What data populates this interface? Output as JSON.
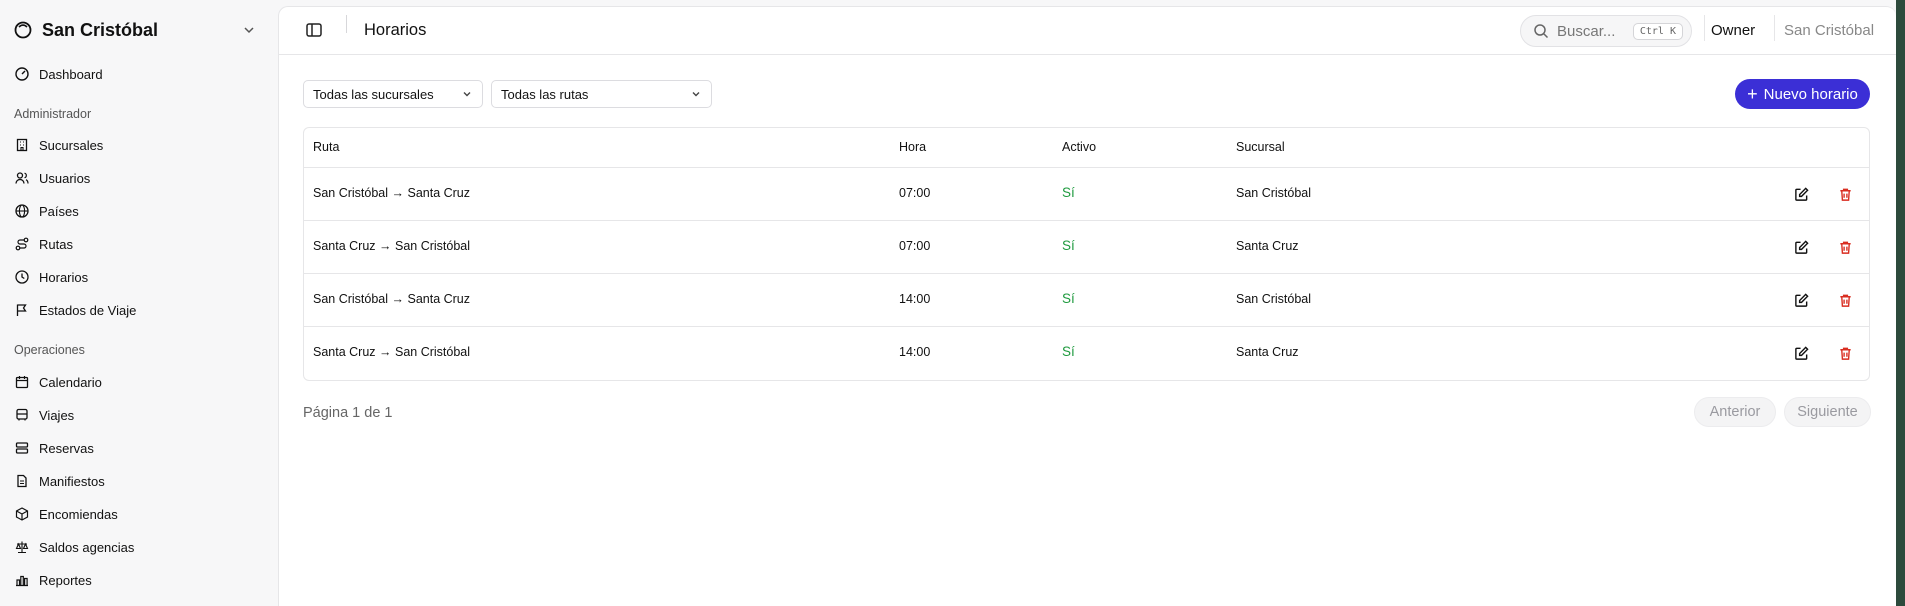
{
  "brand": {
    "name": "San Cristóbal"
  },
  "sidebar": {
    "dashboard": "Dashboard",
    "admin_label": "Administrador",
    "admin_items": [
      "Sucursales",
      "Usuarios",
      "Países",
      "Rutas",
      "Horarios",
      "Estados de Viaje"
    ],
    "ops_label": "Operaciones",
    "ops_items": [
      "Calendario",
      "Viajes",
      "Reservas",
      "Manifiestos",
      "Encomiendas",
      "Saldos agencias",
      "Reportes"
    ]
  },
  "header": {
    "title": "Horarios",
    "search_placeholder": "Buscar...",
    "search_shortcut": "Ctrl K",
    "role": "Owner",
    "tenant": "San Cristóbal"
  },
  "filters": {
    "branch": "Todas las sucursales",
    "route": "Todas las rutas"
  },
  "new_button": "Nuevo horario",
  "table": {
    "headers": [
      "Ruta",
      "Hora",
      "Activo",
      "Sucursal"
    ],
    "rows": [
      {
        "ruta": "San Cristóbal → Santa Cruz",
        "hora": "07:00",
        "activo": "Sí",
        "sucursal": "San Cristóbal"
      },
      {
        "ruta": "Santa Cruz → San Cristóbal",
        "hora": "07:00",
        "activo": "Sí",
        "sucursal": "Santa Cruz"
      },
      {
        "ruta": "San Cristóbal → Santa Cruz",
        "hora": "14:00",
        "activo": "Sí",
        "sucursal": "San Cristóbal"
      },
      {
        "ruta": "Santa Cruz → San Cristóbal",
        "hora": "14:00",
        "activo": "Sí",
        "sucursal": "Santa Cruz"
      }
    ]
  },
  "pagination": {
    "info": "Página 1 de 1",
    "prev": "Anterior",
    "next": "Siguiente"
  },
  "colors": {
    "primary": "#3b2fd6",
    "active_green": "#1e9a3e",
    "delete_red": "#d92d20"
  }
}
